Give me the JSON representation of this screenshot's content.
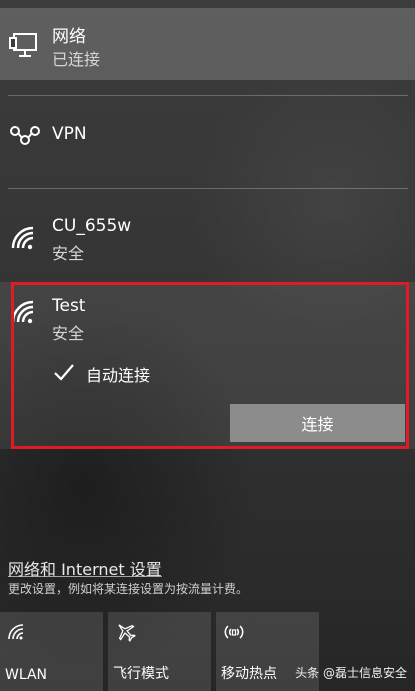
{
  "network_status": {
    "title": "网络",
    "status": "已连接"
  },
  "vpn": {
    "title": "VPN"
  },
  "wifi_list": [
    {
      "ssid": "CU_655w",
      "security": "安全"
    },
    {
      "ssid": "Test",
      "security": "安全",
      "auto_connect_label": "自动连接",
      "auto_connect_checked": true,
      "connect_label": "连接"
    }
  ],
  "settings": {
    "link_text": "网络和 Internet 设置",
    "description": "更改设置，例如将某连接设置为按流量计费。"
  },
  "quick_actions": [
    {
      "label": "WLAN",
      "icon": "wifi-icon"
    },
    {
      "label": "飞行模式",
      "icon": "airplane-icon"
    },
    {
      "label": "移动热点",
      "icon": "hotspot-icon"
    }
  ],
  "watermark": "头条 @磊士信息安全",
  "colors": {
    "highlight": "#e01b24",
    "button": "#8c8c8c"
  }
}
